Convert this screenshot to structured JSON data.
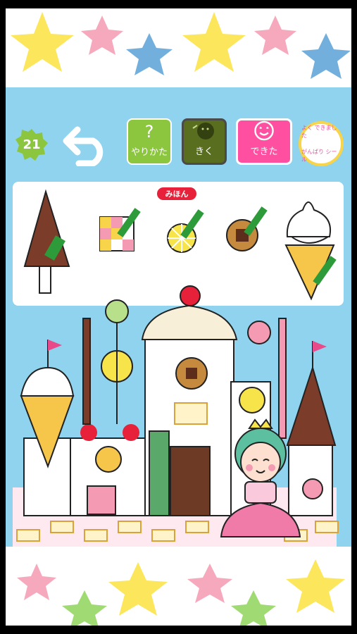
{
  "toolbar": {
    "level": "21",
    "help_label": "やりかた",
    "listen_label": "きく",
    "done_label": "できた",
    "sticker_top": "よく できました",
    "sticker_bottom": "がんばり シール"
  },
  "palette": {
    "sample_badge": "みほん",
    "items": [
      "chocolate-cone-roof",
      "checker-cookie",
      "lemon-slice",
      "chocolate-cookie",
      "ice-cream-cone"
    ]
  },
  "colors": {
    "sky": "#8fd3ee",
    "help": "#8cc63f",
    "listen": "#5a6e1f",
    "done": "#ff4fa1",
    "badge": "#8cc63f",
    "sample": "#e8213a"
  }
}
